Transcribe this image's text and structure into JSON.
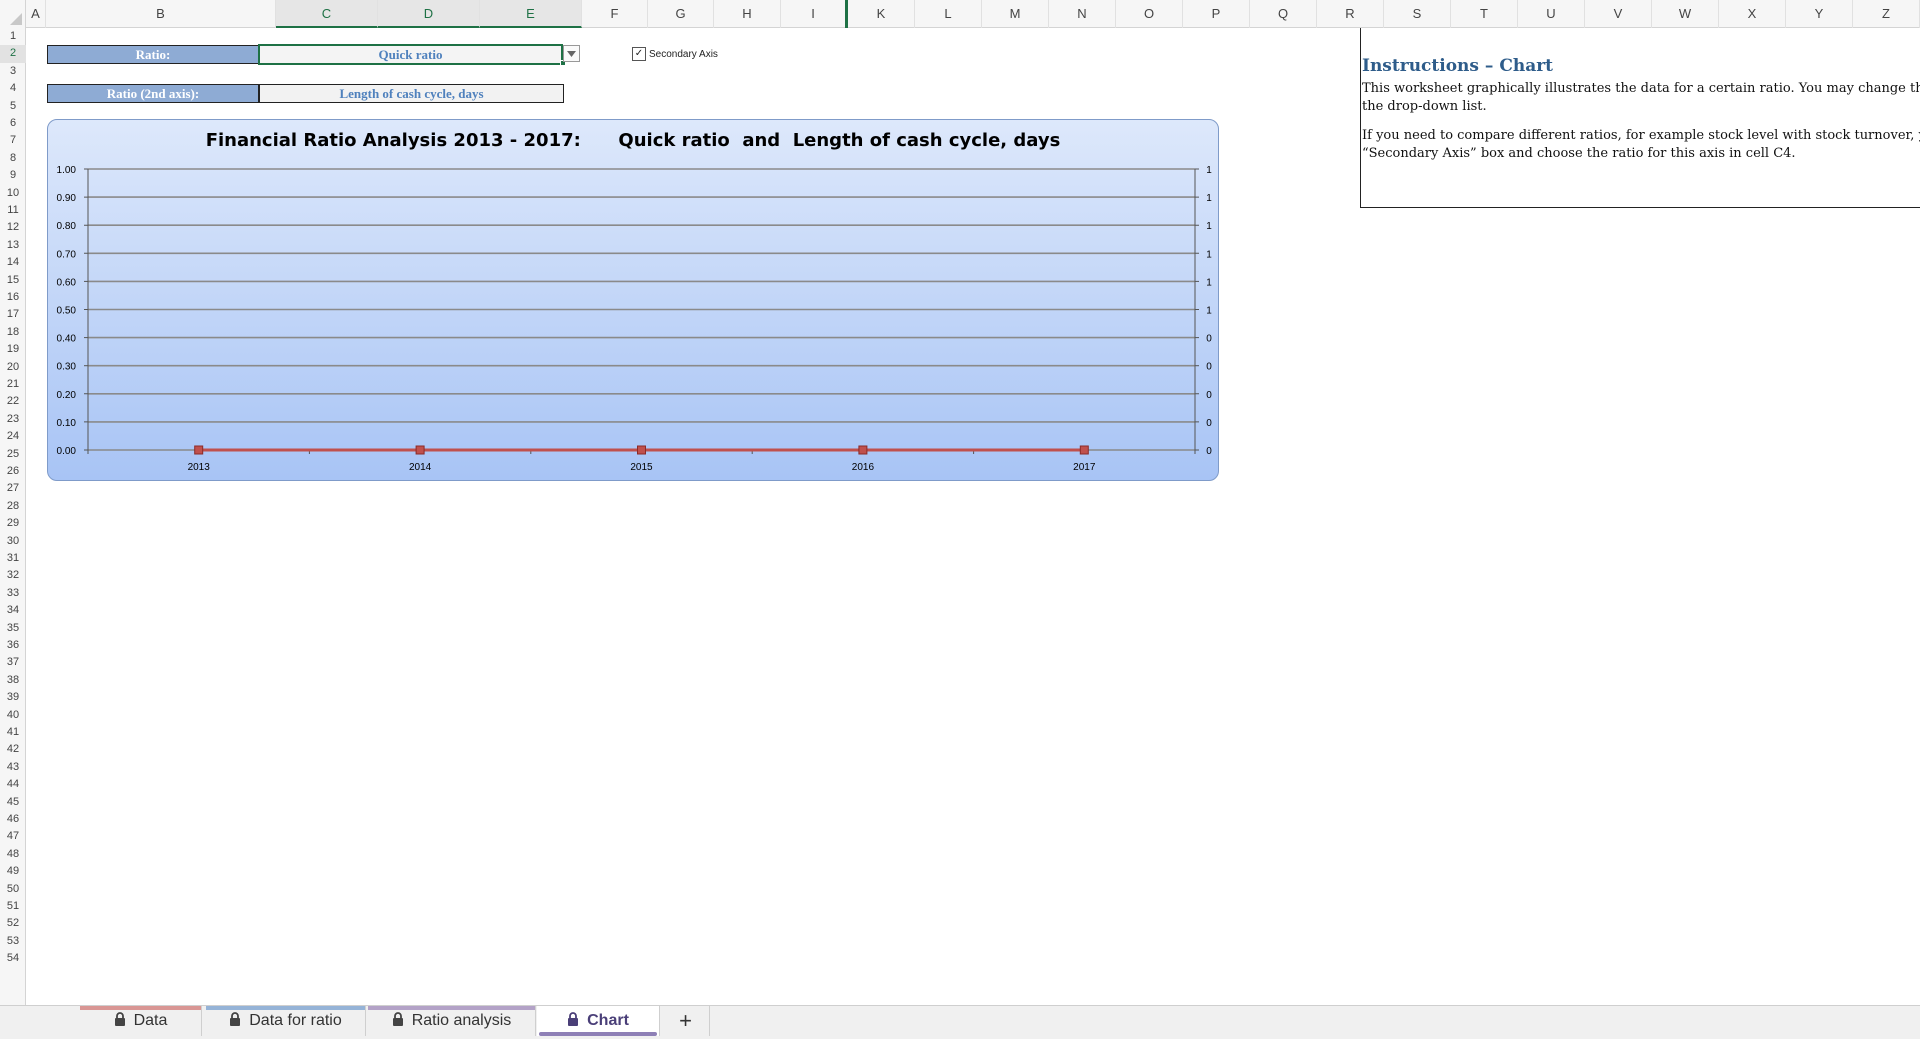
{
  "columns": [
    "A",
    "B",
    "C",
    "D",
    "E",
    "F",
    "G",
    "H",
    "I",
    "K",
    "L",
    "M",
    "N",
    "O",
    "P",
    "Q",
    "R",
    "S",
    "T",
    "U",
    "V",
    "W",
    "X",
    "Y",
    "Z"
  ],
  "rows": [
    "1",
    "2",
    "3",
    "4",
    "5",
    "6",
    "7",
    "8",
    "9",
    "10",
    "11",
    "12",
    "13",
    "14",
    "15",
    "16",
    "17",
    "18",
    "19",
    "20",
    "21",
    "22",
    "23",
    "24",
    "25",
    "26",
    "27",
    "28",
    "29",
    "30",
    "31",
    "32",
    "33",
    "34",
    "35",
    "36",
    "37",
    "38",
    "39",
    "40",
    "41",
    "42",
    "43",
    "44",
    "45",
    "46",
    "47",
    "48",
    "49",
    "50",
    "51",
    "52",
    "53",
    "54"
  ],
  "selected_row": "2",
  "selected_columns": [
    "C",
    "D",
    "E"
  ],
  "controls": {
    "ratio_label": "Ratio:",
    "ratio_value": "Quick ratio",
    "ratio2_label": "Ratio (2nd axis):",
    "ratio2_value": "Length of cash cycle, days",
    "secondary_axis_label": "Secondary Axis",
    "secondary_axis_checked": true,
    "checkbox_mark": "✓"
  },
  "chart_data": {
    "type": "line",
    "title": "Financial Ratio Analysis 2013 - 2017:      Quick ratio  and  Length of cash cycle, days",
    "categories": [
      "2013",
      "2014",
      "2015",
      "2016",
      "2017"
    ],
    "series": [
      {
        "values": [
          0,
          0,
          0,
          0,
          0
        ],
        "color": "#c0504d"
      }
    ],
    "ylim": [
      0,
      1
    ],
    "y_ticks": [
      "1.00",
      "0.90",
      "0.80",
      "0.70",
      "0.60",
      "0.50",
      "0.40",
      "0.30",
      "0.20",
      "0.10",
      "0.00"
    ],
    "y2_ticks": [
      "1",
      "1",
      "1",
      "1",
      "1",
      "1",
      "0",
      "0",
      "0",
      "0",
      "0"
    ],
    "grid": true,
    "background": [
      "#dde8fb",
      "#a8c4f5"
    ]
  },
  "instructions": {
    "title": "Instructions – Chart",
    "p1": "This worksheet graphically illustrates the data for a certain ratio. You may change the using the drop-down list.",
    "p2": "If you need to compare different ratios, for example stock level with stock turnover, yo “Secondary Axis” box and choose the ratio for this axis in cell C4."
  },
  "tabs": [
    {
      "label": "Data",
      "locked": true,
      "stripe": "#d99694",
      "active": false
    },
    {
      "label": "Data for ratio",
      "locked": true,
      "stripe": "#95b3d7",
      "active": false
    },
    {
      "label": "Ratio analysis",
      "locked": true,
      "stripe": "#b3a2c7",
      "active": false
    },
    {
      "label": "Chart",
      "locked": true,
      "stripe": "",
      "active": true
    }
  ],
  "add_tab_label": "+"
}
